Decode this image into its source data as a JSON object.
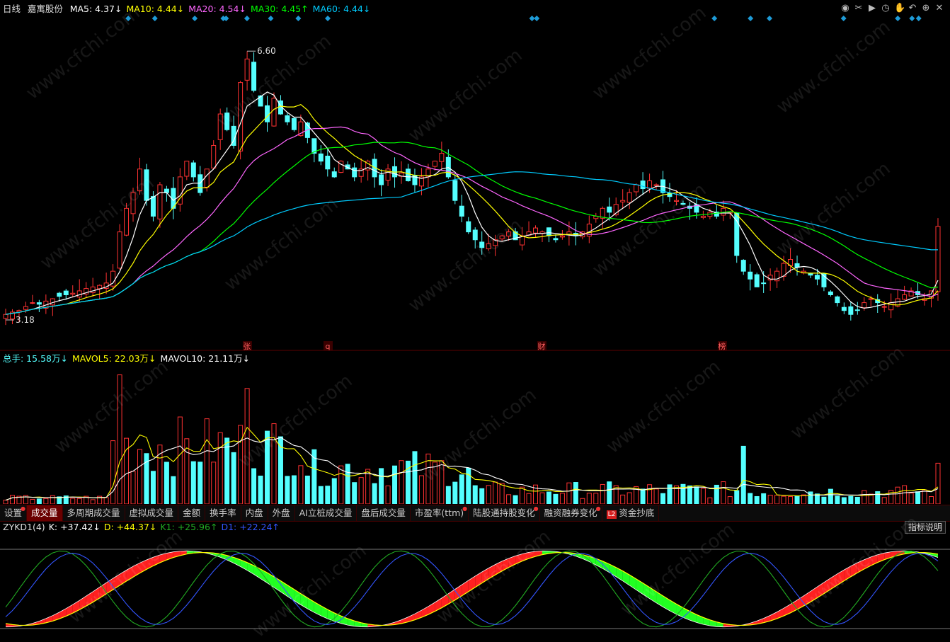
{
  "header": {
    "period": "日线",
    "stock_name": "嘉寓股份",
    "ma": [
      {
        "label": "MA5: 4.37↓",
        "color": "#ffffff"
      },
      {
        "label": "MA10: 4.44↓",
        "color": "#ffff00"
      },
      {
        "label": "MA20: 4.54↓",
        "color": "#ff66ff"
      },
      {
        "label": "MA30: 4.45↑",
        "color": "#00ff00"
      },
      {
        "label": "MA60: 4.44↓",
        "color": "#00ccff"
      }
    ]
  },
  "toolbar_icons": [
    "eye-icon",
    "scissors-icon",
    "play-icon",
    "clock-icon",
    "hand-icon",
    "undo-icon",
    "plus-icon",
    "close-icon"
  ],
  "colors": {
    "up": "#ff3232",
    "down": "#54ffff",
    "ma5": "#ffffff",
    "ma10": "#ffff00",
    "ma20": "#ff66ff",
    "ma30": "#00ff00",
    "ma60": "#00ccff"
  },
  "price_labels": {
    "high": "6.60",
    "low": "3.18"
  },
  "event_markers": [
    "张",
    "q",
    "财",
    "榜"
  ],
  "volume_legend": [
    {
      "label": "总手: 15.58万↓",
      "color": "#54ffff"
    },
    {
      "label": "MAVOL5: 22.03万↓",
      "color": "#ffff00"
    },
    {
      "label": "MAVOL10: 21.11万↓",
      "color": "#ffffff"
    }
  ],
  "tabs": [
    {
      "label": "设置",
      "dot": true,
      "active": false
    },
    {
      "label": "成交量",
      "dot": false,
      "active": true
    },
    {
      "label": "多周期成交量",
      "dot": false,
      "active": false
    },
    {
      "label": "虚拟成交量",
      "dot": false,
      "active": false
    },
    {
      "label": "金额",
      "dot": false,
      "active": false
    },
    {
      "label": "换手率",
      "dot": false,
      "active": false
    },
    {
      "label": "内盘",
      "dot": false,
      "active": false
    },
    {
      "label": "外盘",
      "dot": false,
      "active": false
    },
    {
      "label": "AI立桩成交量",
      "dot": false,
      "active": false
    },
    {
      "label": "盘后成交量",
      "dot": false,
      "active": false
    },
    {
      "label": "市盈率(ttm)",
      "dot": true,
      "active": false
    },
    {
      "label": "陆股通持股变化",
      "dot": true,
      "active": false
    },
    {
      "label": "融资融券变化",
      "dot": true,
      "active": false
    },
    {
      "label": "资金抄底",
      "dot": false,
      "active": false,
      "badge": "L2"
    }
  ],
  "indicator": {
    "name": "ZYKD1(4)",
    "values": [
      {
        "label": "K: +37.42↓",
        "color": "#ffffff"
      },
      {
        "label": "D: +44.37↓",
        "color": "#ffff00"
      },
      {
        "label": "K1: +25.96↑",
        "color": "#22aa22"
      },
      {
        "label": "D1: +22.24↑",
        "color": "#3355ff"
      }
    ],
    "explain_label": "指标说明"
  },
  "watermark": "www.cfchi.com",
  "chart_data": {
    "type": "candlestick",
    "price_range": [
      3.0,
      6.8
    ],
    "high": 6.6,
    "low": 3.18,
    "close_path": [
      3.25,
      3.28,
      3.3,
      3.35,
      3.4,
      3.38,
      3.42,
      3.45,
      3.48,
      3.5,
      3.52,
      3.55,
      3.58,
      3.6,
      3.62,
      3.65,
      3.8,
      4.3,
      4.6,
      4.8,
      5.1,
      4.7,
      4.5,
      4.9,
      4.8,
      4.6,
      5.0,
      5.2,
      5.0,
      4.8,
      5.1,
      5.4,
      5.8,
      5.6,
      5.4,
      6.2,
      6.5,
      6.1,
      5.9,
      5.7,
      6.0,
      5.8,
      5.7,
      5.6,
      5.7,
      5.5,
      5.3,
      5.2,
      5.1,
      5.0,
      5.2,
      5.1,
      5.0,
      5.1,
      5.2,
      5.0,
      4.9,
      5.1,
      5.0,
      5.05,
      4.95,
      4.9,
      5.0,
      5.1,
      5.2,
      5.3,
      5.0,
      4.7,
      4.5,
      4.3,
      4.2,
      4.1,
      4.15,
      4.2,
      4.25,
      4.3,
      4.2,
      4.25,
      4.3,
      4.35,
      4.3,
      4.25,
      4.2,
      4.25,
      4.3,
      4.25,
      4.3,
      4.4,
      4.5,
      4.6,
      4.55,
      4.65,
      4.7,
      4.8,
      4.9,
      4.85,
      4.95,
      4.9,
      4.8,
      4.75,
      4.7,
      4.65,
      4.6,
      4.55,
      4.5,
      4.55,
      4.5,
      4.6,
      4.55,
      4.0,
      3.8,
      3.7,
      3.6,
      3.65,
      3.75,
      3.8,
      3.9,
      3.95,
      3.85,
      3.8,
      3.75,
      3.7,
      3.6,
      3.5,
      3.4,
      3.3,
      3.25,
      3.3,
      3.4,
      3.45,
      3.4,
      3.35,
      3.4,
      3.45,
      3.5,
      3.55,
      3.5,
      3.45,
      3.55,
      4.37
    ],
    "volume_range": [
      0,
      200
    ]
  }
}
